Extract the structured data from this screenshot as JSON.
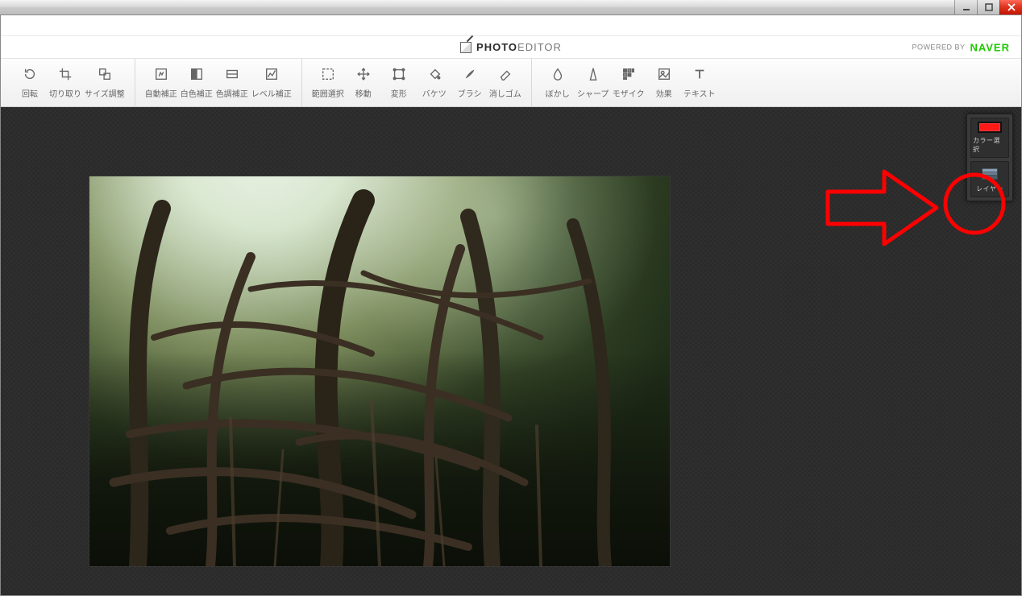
{
  "brand": {
    "bold": "PHOTO",
    "thin": "EDITOR"
  },
  "powered_by": "POWERED BY",
  "naver": "NAVER",
  "toolbar": {
    "groups": [
      {
        "tools": [
          {
            "name": "rotate",
            "label": "回転"
          },
          {
            "name": "crop",
            "label": "切り取り"
          },
          {
            "name": "resize",
            "label": "サイズ調整"
          }
        ]
      },
      {
        "tools": [
          {
            "name": "auto-correct",
            "label": "自動補正"
          },
          {
            "name": "white-correct",
            "label": "白色補正"
          },
          {
            "name": "color-correct",
            "label": "色調補正"
          },
          {
            "name": "level-correct",
            "label": "レベル補正"
          }
        ]
      },
      {
        "tools": [
          {
            "name": "select",
            "label": "範囲選択"
          },
          {
            "name": "move",
            "label": "移動"
          },
          {
            "name": "transform",
            "label": "変形"
          },
          {
            "name": "bucket",
            "label": "バケツ"
          },
          {
            "name": "brush",
            "label": "ブラシ"
          },
          {
            "name": "eraser",
            "label": "消しゴム"
          }
        ]
      },
      {
        "tools": [
          {
            "name": "blur",
            "label": "ぼかし"
          },
          {
            "name": "sharp",
            "label": "シャープ"
          },
          {
            "name": "mosaic",
            "label": "モザイク"
          },
          {
            "name": "effect",
            "label": "効果"
          },
          {
            "name": "text",
            "label": "テキスト"
          }
        ]
      }
    ]
  },
  "side_panel": {
    "color_label": "カラー選択",
    "layer_label": "レイヤー",
    "color_value": "#ff1a1a"
  }
}
